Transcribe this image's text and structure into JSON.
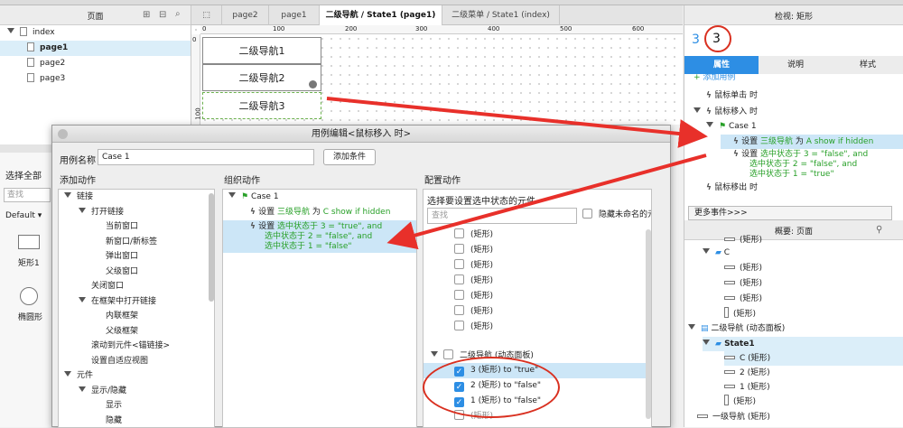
{
  "pages_panel": {
    "title": "页面",
    "tree": [
      "index",
      "page1",
      "page2",
      "page3"
    ]
  },
  "tabs": [
    "page2",
    "page1",
    "二级导航 / State1 (page1)",
    "二级菜单 / State1 (index)"
  ],
  "canvas": {
    "ruler_h": [
      "0",
      "100",
      "200",
      "300",
      "400",
      "500",
      "600"
    ],
    "ruler_v": [
      "0",
      "100"
    ],
    "boxes": [
      "二级导航1",
      "二级导航2",
      "二级导航3"
    ]
  },
  "inspector": {
    "title": "检视: 矩形",
    "count": "3",
    "annotation": "3",
    "tabs": [
      "属性",
      "说明",
      "样式"
    ],
    "add_case": "添加用例",
    "events": {
      "click": "鼠标单击 时",
      "mouse_enter": "鼠标移入 时",
      "case1": "Case 1",
      "action1_prefix": "设置",
      "action1_target": "三级导航",
      "action1_mid": "为",
      "action1_rest": "A show if hidden",
      "action2_prefix": "设置",
      "action2_l1": "选中状态于 3 = \"false\", and",
      "action2_l2": "选中状态于 2 = \"false\", and",
      "action2_l3": "选中状态于 1 = \"true\"",
      "mouse_leave": "鼠标移出 时"
    },
    "more_events": "更多事件>>>"
  },
  "outline": {
    "title": "概要: 页面",
    "rows": [
      "(矩形)",
      "C",
      "(矩形)",
      "(矩形)",
      "(矩形)",
      "(矩形)",
      "二级导航 (动态面板)",
      "State1",
      "C (矩形)",
      "2 (矩形)",
      "1 (矩形)",
      "(矩形)",
      "一级导航 (矩形)"
    ]
  },
  "library": {
    "select_all": "选择全部",
    "search_placeholder": "查找",
    "default_lib": "Default ▾",
    "rect_label": "矩形1",
    "ellipse_label": "椭圆形"
  },
  "dialog": {
    "title": "用例编辑<鼠标移入 时>",
    "case_name_label": "用例名称",
    "case_name_value": "Case 1",
    "add_condition": "添加条件",
    "add_action_title": "添加动作",
    "organize_title": "组织动作",
    "configure_title": "配置动作",
    "actions_tree": [
      {
        "label": "链接",
        "level": 0,
        "tri": true
      },
      {
        "label": "打开链接",
        "level": 1,
        "tri": true
      },
      {
        "label": "当前窗口",
        "level": 2
      },
      {
        "label": "新窗口/新标签",
        "level": 2
      },
      {
        "label": "弹出窗口",
        "level": 2
      },
      {
        "label": "父级窗口",
        "level": 2
      },
      {
        "label": "关闭窗口",
        "level": 1
      },
      {
        "label": "在框架中打开链接",
        "level": 1,
        "tri": true
      },
      {
        "label": "内联框架",
        "level": 2
      },
      {
        "label": "父级框架",
        "level": 2
      },
      {
        "label": "滚动到元件<锚链接>",
        "level": 1
      },
      {
        "label": "设置自适应视图",
        "level": 1
      },
      {
        "label": "元件",
        "level": 0,
        "tri": true
      },
      {
        "label": "显示/隐藏",
        "level": 1,
        "tri": true
      },
      {
        "label": "显示",
        "level": 2
      },
      {
        "label": "隐藏",
        "level": 2
      }
    ],
    "organize": {
      "case": "Case 1",
      "a1_prefix": "设置",
      "a1_target": "三级导航",
      "a1_mid": "为",
      "a1_rest": "C show if hidden",
      "a2_prefix": "设置",
      "a2_l1": "选中状态于 3 = \"true\", and",
      "a2_l2": "选中状态于 2 = \"false\", and",
      "a2_l3": "选中状态于 1 = \"false\""
    },
    "configure": {
      "prompt": "选择要设置选中状态的元件",
      "search_placeholder": "查找",
      "hide_unnamed": "隐藏未命名的元件",
      "rect_rows": [
        "(矩形)",
        "(矩形)",
        "(矩形)",
        "(矩形)",
        "(矩形)",
        "(矩形)",
        "(矩形)"
      ],
      "panel_row": "二级导航 (动态面板)",
      "checked_rows": [
        "3 (矩形) to \"true\"",
        "2 (矩形) to \"false\"",
        "1 (矩形) to \"false\""
      ],
      "tail_row": "(矩形)",
      "last_row": "一级导航 (矩形)"
    }
  },
  "colors": {
    "accent_blue": "#2d8ee4",
    "selection_bg": "#cce6f7",
    "annotation_red": "#d93020",
    "action_green": "#28a028"
  }
}
